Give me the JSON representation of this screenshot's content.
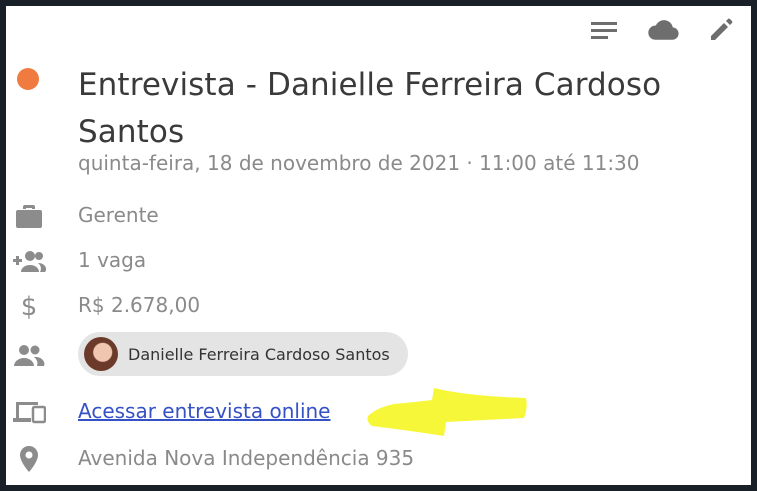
{
  "toolbar": {
    "icons": [
      "menu-lines-icon",
      "cloud-icon",
      "pencil-icon"
    ]
  },
  "event": {
    "title": "Entrevista - Danielle Ferreira Cardoso Santos",
    "datetime": "quinta-feira, 18 de novembro de 2021 · 11:00 até 11:30",
    "status_color": "#f07b40"
  },
  "details": {
    "role": "Gerente",
    "openings": "1 vaga",
    "salary": "R$ 2.678,00",
    "participant": "Danielle Ferreira Cardoso Santos",
    "online_link": "Acessar entrevista online",
    "address": "Avenida Nova Independência 935"
  },
  "colors": {
    "icon_gray": "#8c8c8c",
    "toolbar_icon": "#6e6e6e",
    "link": "#3451c6",
    "highlight": "#f7f73a"
  }
}
